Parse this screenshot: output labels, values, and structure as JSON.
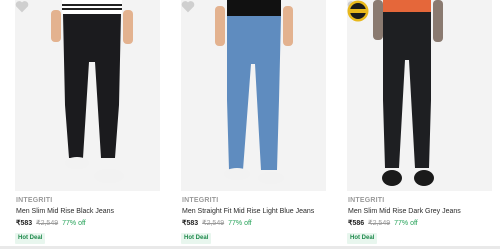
{
  "products": [
    {
      "brand": "INTEGRITI",
      "name": "Men Slim Mid Rise Black Jeans",
      "price": "₹583",
      "mrp": "₹2,549",
      "discount": "77% off",
      "deal": "Hot Deal",
      "colors": {
        "top": "#ffffff",
        "jeans": "#1b1b1e",
        "shoes": "#f2f2f2",
        "skin": "#e3b28f"
      }
    },
    {
      "brand": "INTEGRITI",
      "name": "Men Straight Fit Mid Rise Light Blue Jeans",
      "price": "₹583",
      "mrp": "₹2,549",
      "discount": "77% off",
      "deal": "Hot Deal",
      "colors": {
        "top": "#111111",
        "jeans": "#5f8cbf",
        "shoes": "#f2f2f2",
        "skin": "#e3b28f"
      }
    },
    {
      "brand": "INTEGRITI",
      "name": "Men Slim Mid Rise Dark Grey Jeans",
      "price": "₹586",
      "mrp": "₹2,549",
      "discount": "77% off",
      "deal": "Hot Deal",
      "colors": {
        "top": "#e5673a",
        "jeans": "#1e1f22",
        "shoes": "#1a1a1a",
        "skin": "#e3b28f"
      }
    }
  ],
  "badge_text": "BRAND ASSURANCE"
}
